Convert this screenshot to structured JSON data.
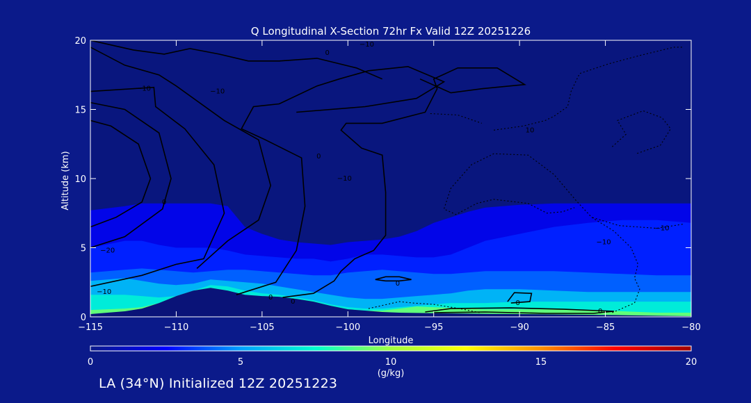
{
  "footer": "LA (34°N) Initialized 12Z 20251223",
  "colors": {
    "background": "#0b1a8a",
    "plot_background": "#09167e",
    "terrain": "#0a1378",
    "contour": "#000000",
    "colorbar": [
      "#0b1a8a",
      "#0000ff",
      "#00a0ff",
      "#00ffd0",
      "#a0ff40",
      "#ffff00",
      "#ff9000",
      "#ff0000",
      "#a00000"
    ]
  },
  "chart_data": {
    "type": "heatmap",
    "title": "Q Longitudinal X-Section 72hr  Fx Valid 12Z 20251226",
    "xlabel": "Longitude",
    "ylabel": "Altitude (km)",
    "xlim": [
      -115,
      -80
    ],
    "ylim": [
      0,
      20
    ],
    "xticks": [
      -115,
      -110,
      -105,
      -100,
      -95,
      -90,
      -85,
      -80
    ],
    "xtick_labels": [
      "−115",
      "−110",
      "−105",
      "−100",
      "−95",
      "−90",
      "−85",
      "−80"
    ],
    "yticks": [
      0,
      5,
      10,
      15,
      20
    ],
    "ytick_labels": [
      "0",
      "5",
      "10",
      "15",
      "20"
    ],
    "colorbar": {
      "label": "(g/kg)",
      "range": [
        0,
        20
      ],
      "ticks": [
        0,
        5,
        10,
        15,
        20
      ],
      "tick_labels": [
        "0",
        "5",
        "10",
        "15",
        "20"
      ]
    },
    "terrain_profile": {
      "lon": [
        -115,
        -113,
        -112,
        -111,
        -110,
        -109,
        -108,
        -107,
        -106,
        -105,
        -104,
        -103,
        -102,
        -101,
        -100,
        -99,
        -98,
        -97,
        -96,
        -95,
        -94,
        -93,
        -92,
        -90,
        -88,
        -86,
        -84,
        -82,
        -80
      ],
      "alt": [
        0.2,
        0.4,
        0.6,
        1.0,
        1.5,
        1.9,
        2.1,
        1.9,
        1.6,
        1.5,
        1.45,
        1.3,
        1.1,
        0.8,
        0.55,
        0.45,
        0.35,
        0.3,
        0.28,
        0.26,
        0.25,
        0.24,
        0.22,
        0.2,
        0.18,
        0.15,
        0.12,
        0.08,
        0.05
      ]
    },
    "moisture_layers": [
      {
        "q": 2,
        "top_alt": [
          7.7,
          8.0,
          8.2,
          8.2,
          8.2,
          8.2,
          8.2,
          8.0,
          6.5,
          6.0,
          5.6,
          5.4,
          5.3,
          5.2,
          5.4,
          5.5,
          5.6,
          5.8,
          6.2,
          6.8,
          7.2,
          7.6,
          7.9,
          8.1,
          8.2,
          8.2,
          8.2,
          8.2,
          8.2
        ]
      },
      {
        "q": 3,
        "top_alt": [
          5.0,
          5.5,
          5.5,
          5.2,
          5.0,
          5.0,
          5.0,
          4.8,
          4.5,
          4.4,
          4.3,
          4.2,
          4.2,
          4.0,
          4.2,
          4.5,
          4.5,
          4.4,
          4.3,
          4.3,
          4.5,
          5.0,
          5.5,
          6.0,
          6.5,
          6.8,
          7.0,
          7.0,
          6.8
        ]
      },
      {
        "q": 4,
        "top_alt": [
          3.2,
          3.4,
          3.5,
          3.4,
          3.3,
          3.2,
          3.3,
          3.4,
          3.4,
          3.3,
          3.2,
          3.1,
          3.0,
          3.0,
          3.2,
          3.3,
          3.4,
          3.3,
          3.2,
          3.1,
          3.1,
          3.2,
          3.3,
          3.3,
          3.3,
          3.2,
          3.1,
          3.0,
          3.0
        ]
      },
      {
        "q": 5.5,
        "top_alt": [
          2.6,
          2.8,
          2.6,
          2.4,
          2.3,
          2.4,
          2.7,
          2.6,
          2.5,
          2.4,
          2.2,
          2.0,
          1.8,
          1.6,
          1.4,
          1.3,
          1.3,
          1.4,
          1.5,
          1.6,
          1.7,
          1.9,
          2.0,
          2.0,
          1.9,
          1.8,
          1.8,
          1.8,
          1.8
        ]
      },
      {
        "q": 7,
        "top_alt": [
          1.6,
          1.6,
          1.5,
          1.4,
          1.5,
          1.9,
          2.3,
          2.2,
          1.9,
          1.7,
          1.6,
          1.4,
          1.2,
          0.9,
          0.7,
          0.6,
          0.6,
          0.7,
          0.8,
          0.9,
          1.0,
          1.0,
          1.0,
          1.1,
          1.1,
          1.1,
          1.1,
          1.1,
          1.1
        ]
      },
      {
        "q": 9,
        "top_alt": [
          0.5,
          0.6,
          0.7,
          1.0,
          1.5,
          1.9,
          2.1,
          1.9,
          1.6,
          1.5,
          1.45,
          1.3,
          1.1,
          0.8,
          0.55,
          0.45,
          0.45,
          0.6,
          0.75,
          0.7,
          0.65,
          0.6,
          0.55,
          0.55,
          0.55,
          0.5,
          0.4,
          0.3,
          0.3
        ]
      }
    ],
    "contours": [
      {
        "label": "−10",
        "style": "solid",
        "points": [
          [
            -115,
            6.5
          ],
          [
            -113.5,
            7.2
          ],
          [
            -112,
            8.3
          ],
          [
            -111.5,
            10
          ],
          [
            -112.2,
            12.5
          ],
          [
            -113.8,
            13.8
          ],
          [
            -115,
            14.2
          ]
        ]
      },
      {
        "label": "−20",
        "style": "solid",
        "points": [
          [
            -115,
            5.0
          ],
          [
            -113,
            5.8
          ],
          [
            -110.8,
            7.8
          ],
          [
            -110.3,
            10
          ],
          [
            -111,
            13.3
          ],
          [
            -113,
            15
          ],
          [
            -115,
            15.5
          ]
        ]
      },
      {
        "label": "−10",
        "style": "solid",
        "points": [
          [
            -115,
            2.2
          ],
          [
            -112,
            3.0
          ],
          [
            -110,
            3.8
          ],
          [
            -108.4,
            4.2
          ],
          [
            -107.2,
            7.5
          ],
          [
            -107.8,
            11
          ],
          [
            -109.5,
            13.6
          ],
          [
            -111.2,
            15.2
          ],
          [
            -111.3,
            16.6
          ],
          [
            -115,
            16.3
          ]
        ]
      },
      {
        "label": "−10",
        "style": "solid",
        "points": [
          [
            -108.8,
            3.5
          ],
          [
            -107,
            5.5
          ],
          [
            -105.2,
            7.0
          ],
          [
            -104.5,
            9.5
          ],
          [
            -105.2,
            12.8
          ],
          [
            -107.2,
            14.2
          ],
          [
            -110,
            16.7
          ],
          [
            -111,
            17.5
          ],
          [
            -113,
            18.2
          ],
          [
            -115,
            19.5
          ]
        ]
      },
      {
        "label": "−10",
        "style": "solid",
        "points": [
          [
            -106.5,
            1.6
          ],
          [
            -104.2,
            2.5
          ],
          [
            -103.0,
            4.8
          ],
          [
            -102.5,
            8.0
          ],
          [
            -102.7,
            11.5
          ],
          [
            -104.8,
            12.8
          ],
          [
            -106.2,
            13.6
          ],
          [
            -105.5,
            15.2
          ],
          [
            -104,
            15.4
          ],
          [
            -101.8,
            16.7
          ],
          [
            -100.5,
            17.2
          ],
          [
            -98.8,
            17.8
          ],
          [
            -96.5,
            18.1
          ],
          [
            -94.4,
            17.0
          ],
          [
            -96,
            15.8
          ],
          [
            -99,
            15.2
          ],
          [
            -103,
            14.8
          ]
        ]
      },
      {
        "label": "−10",
        "style": "solid",
        "points": [
          [
            -115,
            20
          ],
          [
            -112.5,
            19.3
          ],
          [
            -110.7,
            19.0
          ],
          [
            -109.2,
            19.4
          ],
          [
            -107.5,
            19.0
          ],
          [
            -105.8,
            18.5
          ],
          [
            -104,
            18.5
          ],
          [
            -101.8,
            18.7
          ],
          [
            -99.5,
            18.0
          ],
          [
            -98,
            17.2
          ]
        ]
      },
      {
        "label": "0",
        "style": "solid",
        "points": [
          [
            -103.8,
            1.4
          ],
          [
            -102,
            1.7
          ],
          [
            -100.8,
            2.6
          ],
          [
            -100.4,
            3.3
          ],
          [
            -99.6,
            4.2
          ],
          [
            -98.5,
            4.8
          ],
          [
            -97.8,
            5.9
          ],
          [
            -97.8,
            9.0
          ],
          [
            -98.0,
            11.7
          ],
          [
            -99.2,
            12.2
          ],
          [
            -100.4,
            13.5
          ],
          [
            -100.1,
            14.0
          ],
          [
            -98.0,
            14.0
          ],
          [
            -95.5,
            14.8
          ],
          [
            -94.8,
            16.5
          ],
          [
            -95.0,
            17.2
          ],
          [
            -93.6,
            18.0
          ],
          [
            -91.3,
            18.0
          ],
          [
            -89.7,
            16.8
          ],
          [
            -92.2,
            16.5
          ],
          [
            -94.0,
            16.2
          ],
          [
            -95.8,
            17.2
          ]
        ]
      },
      {
        "label": "0",
        "style": "solid",
        "points": [
          [
            -95.5,
            0.35
          ],
          [
            -94,
            0.6
          ],
          [
            -90.5,
            0.65
          ],
          [
            -87.4,
            0.55
          ],
          [
            -85.5,
            0.45
          ],
          [
            -84.5,
            0.4
          ],
          [
            -85.7,
            0.25
          ],
          [
            -88.5,
            0.25
          ],
          [
            -92,
            0.35
          ],
          [
            -95,
            0.3
          ]
        ]
      },
      {
        "label": "0",
        "style": "solid",
        "points": [
          [
            -97.8,
            2.6
          ],
          [
            -97.0,
            2.6
          ],
          [
            -96.3,
            2.7
          ],
          [
            -97.0,
            2.9
          ],
          [
            -97.8,
            2.9
          ],
          [
            -98.4,
            2.7
          ],
          [
            -97.8,
            2.6
          ]
        ]
      },
      {
        "label": "0",
        "style": "solid",
        "points": [
          [
            -90.5,
            1.0
          ],
          [
            -89.4,
            1.1
          ],
          [
            -89.3,
            1.7
          ],
          [
            -90.3,
            1.75
          ],
          [
            -90.7,
            1.1
          ]
        ]
      },
      {
        "label": "10",
        "style": "dotted",
        "points": [
          [
            -91.5,
            13.5
          ],
          [
            -89.8,
            13.8
          ],
          [
            -88.5,
            14.2
          ],
          [
            -88,
            14.5
          ],
          [
            -87.2,
            15.2
          ],
          [
            -87.0,
            16.3
          ],
          [
            -86.5,
            17.6
          ],
          [
            -84.8,
            18.3
          ],
          [
            -83,
            18.9
          ],
          [
            -81,
            19.5
          ],
          [
            -80.5,
            19.5
          ]
        ]
      },
      {
        "label": "",
        "style": "dotted",
        "points": [
          [
            -98.8,
            0.6
          ],
          [
            -97,
            1.1
          ],
          [
            -96.2,
            1.0
          ],
          [
            -95,
            0.9
          ],
          [
            -93.5,
            0.6
          ],
          [
            -92.3,
            0.3
          ]
        ]
      },
      {
        "label": "",
        "style": "dotted",
        "points": [
          [
            -84.6,
            0.3
          ],
          [
            -83.3,
            1.0
          ],
          [
            -83.0,
            2.0
          ],
          [
            -83.3,
            2.8
          ],
          [
            -83.1,
            3.8
          ],
          [
            -83.5,
            5.0
          ],
          [
            -84.5,
            6.2
          ],
          [
            -85.8,
            7.2
          ],
          [
            -86.7,
            8.4
          ],
          [
            -88,
            10.3
          ],
          [
            -89.5,
            11.7
          ],
          [
            -91.5,
            11.8
          ],
          [
            -92.8,
            11.0
          ],
          [
            -94.0,
            9.3
          ],
          [
            -94.4,
            7.8
          ],
          [
            -93.7,
            7.4
          ],
          [
            -92.5,
            8.2
          ],
          [
            -91.5,
            8.5
          ],
          [
            -89.5,
            8.2
          ],
          [
            -88.4,
            7.5
          ],
          [
            -87.5,
            7.6
          ],
          [
            -86.8,
            7.9
          ]
        ]
      },
      {
        "label": "−10",
        "style": "dotted",
        "points": [
          [
            -80.5,
            6.7
          ],
          [
            -82,
            6.4
          ],
          [
            -84.2,
            6.6
          ],
          [
            -85.8,
            7.2
          ]
        ]
      },
      {
        "label": "",
        "style": "dotted",
        "points": [
          [
            -84.6,
            12.3
          ],
          [
            -83.8,
            13.2
          ],
          [
            -84.3,
            14.2
          ],
          [
            -82.8,
            14.9
          ],
          [
            -81.7,
            14.4
          ],
          [
            -81.2,
            13.6
          ],
          [
            -81.8,
            12.4
          ],
          [
            -83.2,
            11.8
          ]
        ]
      },
      {
        "label": "",
        "style": "dotted",
        "points": [
          [
            -95.2,
            14.7
          ],
          [
            -93.6,
            14.6
          ],
          [
            -92.2,
            14.0
          ]
        ]
      }
    ],
    "contour_labels": [
      {
        "text": "0",
        "lon": -101.2,
        "alt": 19.1
      },
      {
        "text": "−10",
        "lon": -98.9,
        "alt": 19.7
      },
      {
        "text": "−10",
        "lon": -111.9,
        "alt": 16.5
      },
      {
        "text": "−10",
        "lon": -107.6,
        "alt": 16.3
      },
      {
        "text": "0",
        "lon": -101.7,
        "alt": 11.6
      },
      {
        "text": "−10",
        "lon": -100.2,
        "alt": 10.0
      },
      {
        "text": "−10",
        "lon": -85.1,
        "alt": 5.4
      },
      {
        "text": "10",
        "lon": -89.4,
        "alt": 13.5
      },
      {
        "text": "0",
        "lon": -110.7,
        "alt": 8.3
      },
      {
        "text": "−20",
        "lon": -114,
        "alt": 4.8
      },
      {
        "text": "−10",
        "lon": -114.2,
        "alt": 1.8
      },
      {
        "text": "0",
        "lon": -104.5,
        "alt": 1.4
      },
      {
        "text": "0",
        "lon": -103.2,
        "alt": 1.1
      },
      {
        "text": "0",
        "lon": -97.1,
        "alt": 2.4
      },
      {
        "text": "0",
        "lon": -90.1,
        "alt": 1.0
      },
      {
        "text": "0",
        "lon": -85.3,
        "alt": 0.4
      },
      {
        "text": "−10",
        "lon": -81.7,
        "alt": 6.4
      }
    ]
  }
}
